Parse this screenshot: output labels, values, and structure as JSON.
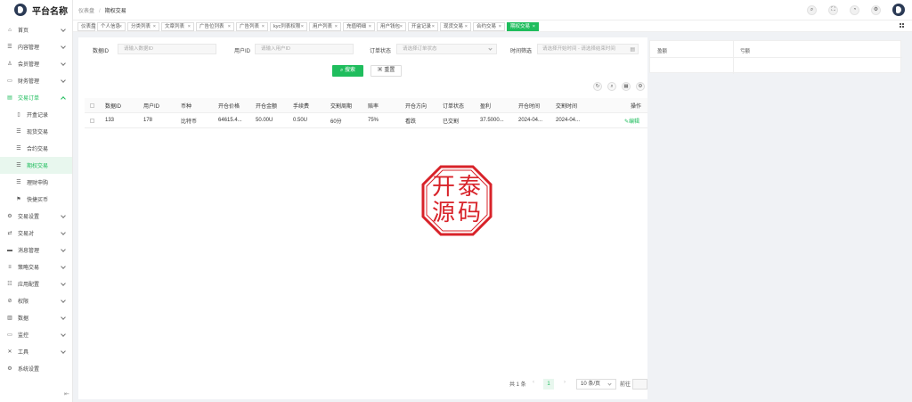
{
  "app": {
    "name": "平台名称"
  },
  "breadcrumb": [
    "仪表盘",
    "期权交易"
  ],
  "sidebar": {
    "items": [
      {
        "icon": "home-icon",
        "label": "首页",
        "chev": true
      },
      {
        "icon": "list-icon",
        "label": "内容管理",
        "chev": true
      },
      {
        "icon": "users-icon",
        "label": "会员管理",
        "chev": true
      },
      {
        "icon": "wallet-icon",
        "label": "财务管理",
        "chev": true
      },
      {
        "icon": "orders-icon",
        "label": "交易订单",
        "chev": true,
        "open": true
      },
      {
        "icon": "doc-icon",
        "label": "开盒记录",
        "sub": true
      },
      {
        "icon": "lines-icon",
        "label": "现货交易",
        "sub": true
      },
      {
        "icon": "lines-icon",
        "label": "合约交易",
        "sub": true
      },
      {
        "icon": "lines-icon",
        "label": "期权交易",
        "sub": true,
        "selected": true
      },
      {
        "icon": "lines-icon",
        "label": "理财申购",
        "sub": true
      },
      {
        "icon": "flag-icon",
        "label": "快捷买币",
        "sub": true
      },
      {
        "icon": "settings-icon",
        "label": "交易设置",
        "chev": true
      },
      {
        "icon": "pair-icon",
        "label": "交易对",
        "chev": true
      },
      {
        "icon": "message-icon",
        "label": "消息管理",
        "chev": true
      },
      {
        "icon": "strategy-icon",
        "label": "策略交易",
        "chev": true
      },
      {
        "icon": "app-config-icon",
        "label": "应用配置",
        "chev": true
      },
      {
        "icon": "permission-icon",
        "label": "权限",
        "chev": true
      },
      {
        "icon": "data-icon",
        "label": "数据",
        "chev": true
      },
      {
        "icon": "monitor-icon",
        "label": "监控",
        "chev": true
      },
      {
        "icon": "tools-icon",
        "label": "工具",
        "chev": true
      },
      {
        "icon": "gear-icon",
        "label": "系统设置"
      }
    ]
  },
  "tabs": [
    {
      "label": "仪表盘",
      "closable": false
    },
    {
      "label": "个人信息",
      "closable": true
    },
    {
      "label": "分类列表",
      "closable": true
    },
    {
      "label": "文章列表",
      "closable": true
    },
    {
      "label": "广告位列表",
      "closable": true
    },
    {
      "label": "广告列表",
      "closable": true
    },
    {
      "label": "kyc列表权限",
      "closable": true
    },
    {
      "label": "用户列表",
      "closable": true
    },
    {
      "label": "充值明细",
      "closable": true
    },
    {
      "label": "用户钱包",
      "closable": true
    },
    {
      "label": "开盒记录",
      "closable": true
    },
    {
      "label": "现货交易",
      "closable": true
    },
    {
      "label": "合约交易",
      "closable": true
    },
    {
      "label": "期权交易",
      "closable": true,
      "active": true
    }
  ],
  "filters": {
    "data_id": {
      "label": "数据ID",
      "placeholder": "请输入数据ID"
    },
    "user_id": {
      "label": "用户ID",
      "placeholder": "请输入用户ID"
    },
    "order_status": {
      "label": "订单状态",
      "placeholder": "请选择订单状态"
    },
    "time": {
      "label": "时间筛选",
      "start": "请选择开始时间",
      "sep": "-",
      "end": "请选择结束时间"
    },
    "search_label": "搜索",
    "reset_label": "重置"
  },
  "table": {
    "headers": [
      "数据ID",
      "用户ID",
      "币种",
      "开仓价格",
      "开仓金额",
      "手续费",
      "交割周期",
      "赔率",
      "开仓方向",
      "订单状态",
      "盈利",
      "开仓时间",
      "交割时间",
      "操作"
    ],
    "rows": [
      [
        "133",
        "178",
        "比特币",
        "64615.4...",
        "50.00U",
        "0.50U",
        "60分",
        "75%",
        "看跌",
        "已交割",
        "37.5000...",
        "2024-04...",
        "2024-04...",
        "编辑"
      ]
    ]
  },
  "side_panel": {
    "col1": "盈额",
    "col2": "亏额"
  },
  "pagination": {
    "total": "共 1 条",
    "current": "1",
    "size": "10 条/页",
    "jump": "前往"
  },
  "watermark": {
    "text": "开泰源码",
    "color": "#d8232a"
  },
  "colors": {
    "accent": "#1fbd5d"
  }
}
